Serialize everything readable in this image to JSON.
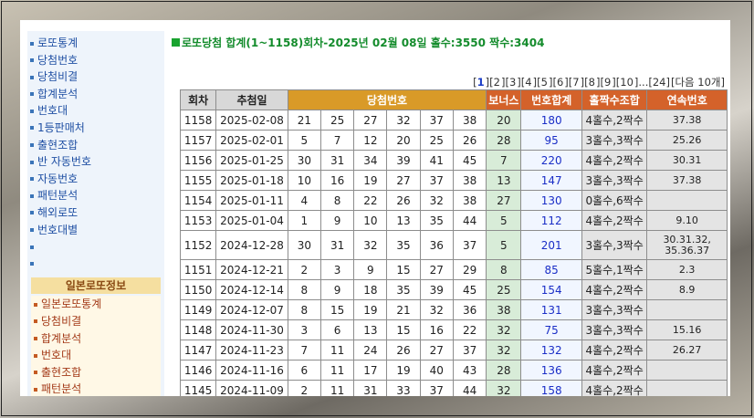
{
  "sidebar": {
    "items": [
      "로또통계",
      "당첨번호",
      "당첨비결",
      "합계분석",
      "번호대",
      "1등판매처",
      "출현조합",
      "반 자동번호",
      "자동번호",
      "패턴분석",
      "해외로또",
      "번호대별",
      "",
      ""
    ],
    "japan_header": "일본로또정보",
    "japan_items": [
      "일본로또통계",
      "당첨비결",
      "합계분석",
      "번호대",
      "출현조합",
      "패턴분석"
    ]
  },
  "title": "로또당첨 합계(1~1158)회차-2025년 02월 08일 홀수:3550 짝수:3404",
  "pager": {
    "pages": [
      "1",
      "2",
      "3",
      "4",
      "5",
      "6",
      "7",
      "8",
      "9",
      "10"
    ],
    "current": "1",
    "ellipsis": "...",
    "last": "[24]",
    "next": "[다음 10개]"
  },
  "table": {
    "headers": {
      "round": "회차",
      "date": "추첨일",
      "numbers": "당첨번호",
      "bonus": "보너스",
      "sum": "번호합계",
      "odd_even": "홀짝수조합",
      "consecutive": "연속번호"
    },
    "rows": [
      {
        "round": "1158",
        "date": "2025-02-08",
        "nums": [
          "21",
          "25",
          "27",
          "32",
          "37",
          "38"
        ],
        "bonus": "20",
        "sum": "180",
        "oe": "4홀수,2짝수",
        "cons": "37.38"
      },
      {
        "round": "1157",
        "date": "2025-02-01",
        "nums": [
          "5",
          "7",
          "12",
          "20",
          "25",
          "26"
        ],
        "bonus": "28",
        "sum": "95",
        "oe": "3홀수,3짝수",
        "cons": "25.26"
      },
      {
        "round": "1156",
        "date": "2025-01-25",
        "nums": [
          "30",
          "31",
          "34",
          "39",
          "41",
          "45"
        ],
        "bonus": "7",
        "sum": "220",
        "oe": "4홀수,2짝수",
        "cons": "30.31"
      },
      {
        "round": "1155",
        "date": "2025-01-18",
        "nums": [
          "10",
          "16",
          "19",
          "27",
          "37",
          "38"
        ],
        "bonus": "13",
        "sum": "147",
        "oe": "3홀수,3짝수",
        "cons": "37.38"
      },
      {
        "round": "1154",
        "date": "2025-01-11",
        "nums": [
          "4",
          "8",
          "22",
          "26",
          "32",
          "38"
        ],
        "bonus": "27",
        "sum": "130",
        "oe": "0홀수,6짝수",
        "cons": ""
      },
      {
        "round": "1153",
        "date": "2025-01-04",
        "nums": [
          "1",
          "9",
          "10",
          "13",
          "35",
          "44"
        ],
        "bonus": "5",
        "sum": "112",
        "oe": "4홀수,2짝수",
        "cons": "9.10"
      },
      {
        "round": "1152",
        "date": "2024-12-28",
        "nums": [
          "30",
          "31",
          "32",
          "35",
          "36",
          "37"
        ],
        "bonus": "5",
        "sum": "201",
        "oe": "3홀수,3짝수",
        "cons": "30.31.32,",
        "cons2": "35.36.37"
      },
      {
        "round": "1151",
        "date": "2024-12-21",
        "nums": [
          "2",
          "3",
          "9",
          "15",
          "27",
          "29"
        ],
        "bonus": "8",
        "sum": "85",
        "oe": "5홀수,1짝수",
        "cons": "2.3"
      },
      {
        "round": "1150",
        "date": "2024-12-14",
        "nums": [
          "8",
          "9",
          "18",
          "35",
          "39",
          "45"
        ],
        "bonus": "25",
        "sum": "154",
        "oe": "4홀수,2짝수",
        "cons": "8.9"
      },
      {
        "round": "1149",
        "date": "2024-12-07",
        "nums": [
          "8",
          "15",
          "19",
          "21",
          "32",
          "36"
        ],
        "bonus": "38",
        "sum": "131",
        "oe": "3홀수,3짝수",
        "cons": ""
      },
      {
        "round": "1148",
        "date": "2024-11-30",
        "nums": [
          "3",
          "6",
          "13",
          "15",
          "16",
          "22"
        ],
        "bonus": "32",
        "sum": "75",
        "oe": "3홀수,3짝수",
        "cons": "15.16"
      },
      {
        "round": "1147",
        "date": "2024-11-23",
        "nums": [
          "7",
          "11",
          "24",
          "26",
          "27",
          "37"
        ],
        "bonus": "32",
        "sum": "132",
        "oe": "4홀수,2짝수",
        "cons": "26.27"
      },
      {
        "round": "1146",
        "date": "2024-11-16",
        "nums": [
          "6",
          "11",
          "17",
          "19",
          "40",
          "43"
        ],
        "bonus": "28",
        "sum": "136",
        "oe": "4홀수,2짝수",
        "cons": ""
      },
      {
        "round": "1145",
        "date": "2024-11-09",
        "nums": [
          "2",
          "11",
          "31",
          "33",
          "37",
          "44"
        ],
        "bonus": "32",
        "sum": "158",
        "oe": "4홀수,2짝수",
        "cons": ""
      }
    ]
  }
}
